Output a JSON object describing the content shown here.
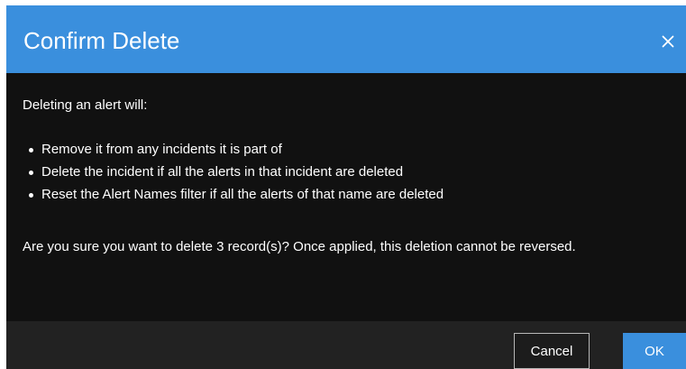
{
  "dialog": {
    "title": "Confirm Delete",
    "close_icon": "close-icon",
    "intro": "Deleting an alert will:",
    "bullets": [
      "Remove it from any incidents it is part of",
      "Delete the incident if all the alerts in that incident are deleted",
      "Reset the Alert Names filter if all the alerts of that name are deleted"
    ],
    "confirmation": "Are you sure you want to delete 3 record(s)? Once applied, this deletion cannot be reversed.",
    "cancel_label": "Cancel",
    "ok_label": "OK"
  },
  "colors": {
    "header": "#3a8fdd",
    "body": "#111111",
    "footer": "#222222",
    "ok_button": "#3a8fdd",
    "text": "#ffffff"
  }
}
